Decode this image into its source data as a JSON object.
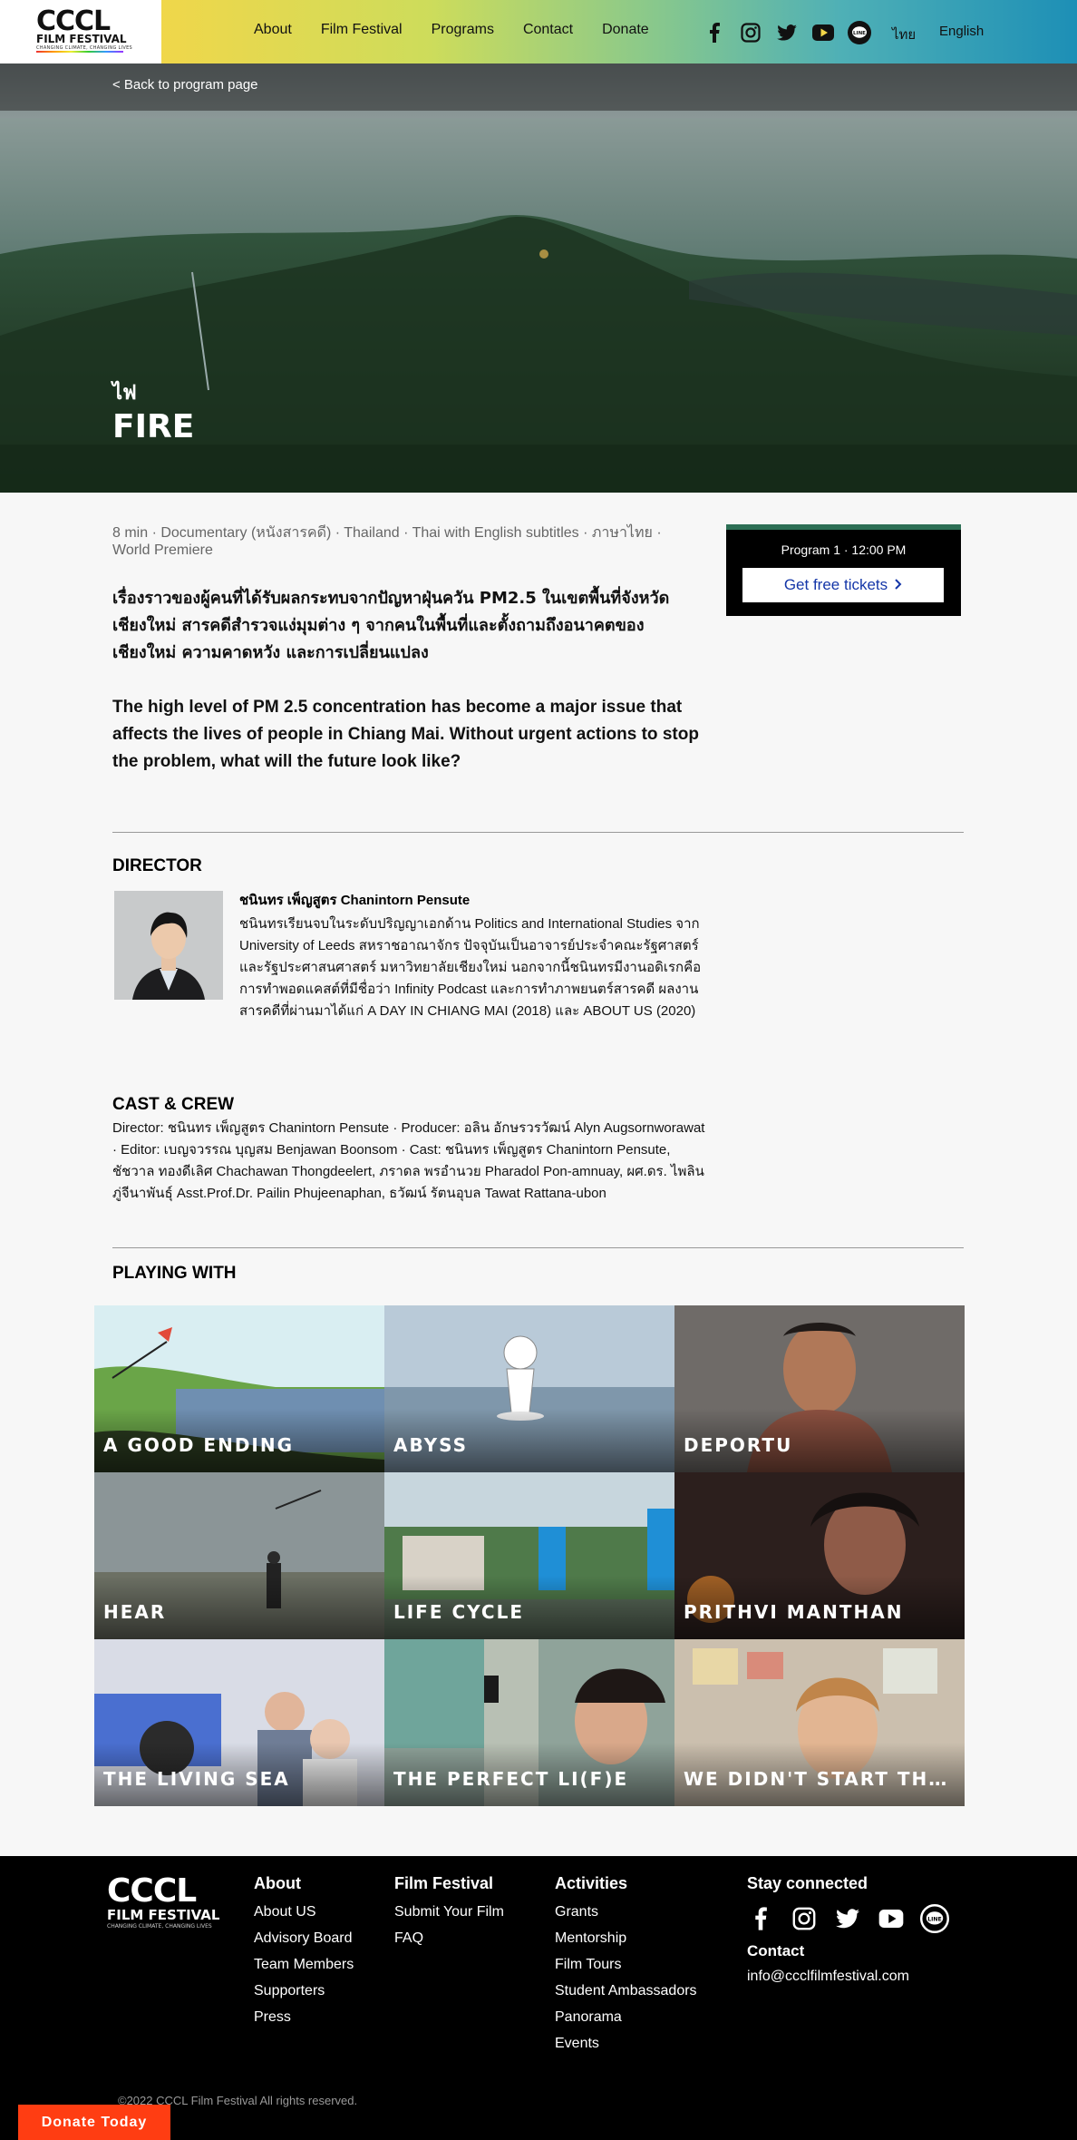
{
  "header": {
    "logo": {
      "main": "CCCL",
      "sub": "FILM FESTIVAL",
      "tagline": "CHANGING CLIMATE, CHANGING LIVES"
    },
    "nav": [
      "About",
      "Film Festival",
      "Programs",
      "Contact",
      "Donate"
    ],
    "social_icons": [
      "facebook-icon",
      "instagram-icon",
      "twitter-icon",
      "youtube-icon",
      "line-icon"
    ],
    "languages": {
      "thai": "ไทย",
      "english": "English"
    }
  },
  "hero": {
    "back_link": "< Back to program page",
    "title_thai": "ไฟ",
    "title": "FIRE"
  },
  "film": {
    "meta": "8 min · Documentary (หนังสารคดี) · Thailand · Thai with English subtitles · ภาษาไทย · World Premiere",
    "description_thai": "เรื่องราวของผู้คนที่ได้รับผลกระทบจากปัญหาฝุ่นควัน PM2.5 ในเขตพื้นที่จังหวัดเชียงใหม่ สารคดีสำรวจแง่มุมต่าง ๆ จากคนในพื้นที่และตั้งถามถึงอนาคตของเชียงใหม่ ความคาดหวัง และการเปลี่ยนแปลง",
    "description_en": "The high level of PM 2.5 concentration has become a major issue that affects the lives of people in Chiang Mai. Without urgent actions to stop the problem, what will the future look like?"
  },
  "tickets": {
    "program": "Program 1 · 12:00 PM",
    "button": "Get free tickets"
  },
  "director": {
    "heading": "DIRECTOR",
    "name": "ชนินทร เพ็ญสูตร Chanintorn Pensute",
    "bio": "ชนินทรเรียนจบในระดับปริญญาเอกด้าน Politics and International Studies จาก University of Leeds สหราชอาณาจักร ปัจจุบันเป็นอาจารย์ประจำคณะรัฐศาสตร์และรัฐประศาสนศาสตร์ มหาวิทยาลัยเชียงใหม่ นอกจากนี้ชนินทรมีงานอดิเรกคือการทำพอดแคสต์ที่มีชื่อว่า Infinity Podcast และการทำภาพยนตร์สารคดี ผลงานสารคดีที่ผ่านมาได้แก่ A DAY IN CHIANG MAI (2018) และ ABOUT US (2020)"
  },
  "cast": {
    "heading": "CAST & CREW",
    "text": "Director: ชนินทร เพ็ญสูตร Chanintorn Pensute · Producer: อลิน อักษรวรวัฒน์ Alyn Augsornworawat · Editor: เบญจวรรณ บุญสม Benjawan Boonsom · Cast: ชนินทร เพ็ญสูตร Chanintorn Pensute, ชัชวาล ทองดีเลิศ Chachawan Thongdeelert, ภราดล พรอำนวย Pharadol Pon-amnuay, ผศ.ดร. ไพลิน ภู่จีนาพันธุ์ Asst.Prof.Dr. Pailin Phujeenaphan, ธวัฒน์ รัตนอุบล Tawat Rattana-ubon"
  },
  "playing_with": {
    "heading": "PLAYING WITH",
    "films": [
      {
        "title": "A GOOD ENDING",
        "bg": "#7ea65a"
      },
      {
        "title": "ABYSS",
        "bg": "#9fb6c7"
      },
      {
        "title": "DEPORTU",
        "bg": "#6f6b68"
      },
      {
        "title": "HEAR",
        "bg": "#7f8a8c"
      },
      {
        "title": "LIFE CYCLE",
        "bg": "#5f8f86"
      },
      {
        "title": "PRITHVI MANTHAN",
        "bg": "#3b2b2a"
      },
      {
        "title": "THE LIVING SEA",
        "bg": "#7a86b0"
      },
      {
        "title": "THE PERFECT LI(F)E",
        "bg": "#7a8a84"
      },
      {
        "title": "WE DIDN'T START THE FIRE",
        "bg": "#a89886"
      }
    ]
  },
  "footer": {
    "logo": {
      "main": "CCCL",
      "sub": "FILM FESTIVAL",
      "tagline": "CHANGING CLIMATE, CHANGING LIVES"
    },
    "about": {
      "heading": "About",
      "items": [
        "About US",
        "Advisory Board",
        "Team Members",
        "Supporters",
        "Press"
      ]
    },
    "film_festival": {
      "heading": "Film Festival",
      "items": [
        "Submit Your Film",
        "FAQ"
      ]
    },
    "activities": {
      "heading": "Activities",
      "items": [
        "Grants",
        "Mentorship",
        "Film Tours",
        "Student Ambassadors",
        "Panorama",
        "Events"
      ]
    },
    "stay_connected": "Stay connected",
    "contact_heading": "Contact",
    "email": "info@ccclfilmfestival.com",
    "copyright": "©2022 CCCL Film Festival All rights reserved."
  },
  "donate_fab": "Donate Today"
}
